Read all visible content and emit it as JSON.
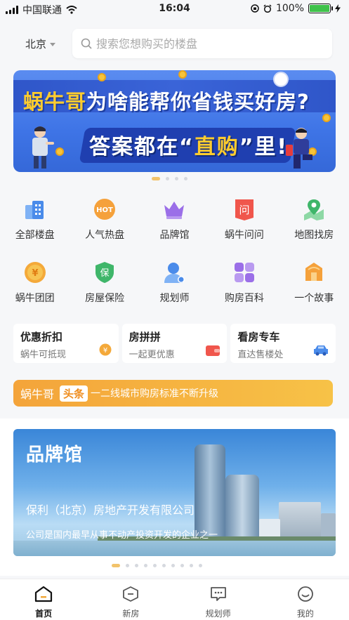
{
  "status_bar": {
    "carrier": "中国联通",
    "time": "16:04",
    "battery": "100%",
    "battery_level": 1.0
  },
  "location": {
    "city": "北京"
  },
  "search": {
    "placeholder": "搜索您想购买的楼盘"
  },
  "banner": {
    "line1_brand": "蜗牛哥",
    "line1_rest": "为啥能帮你省钱买好房?",
    "line2_pre": "答案都在“",
    "line2_highlight": "直购",
    "line2_post": "”里!",
    "pages": 4,
    "active_page": 0
  },
  "quick_menu": [
    {
      "label": "全部楼盘",
      "icon": "buildings-icon",
      "color": "#4a8bea"
    },
    {
      "label": "人气热盘",
      "icon": "hot-icon",
      "color": "#f5a13b"
    },
    {
      "label": "品牌馆",
      "icon": "crown-icon",
      "color": "#9b6fe8"
    },
    {
      "label": "蜗牛问问",
      "icon": "question-icon",
      "color": "#f0564c"
    },
    {
      "label": "地图找房",
      "icon": "map-pin-icon",
      "color": "#3fb66a"
    },
    {
      "label": "蜗牛团团",
      "icon": "coin-icon",
      "color": "#f4a93a"
    },
    {
      "label": "房屋保险",
      "icon": "shield-icon",
      "color": "#3fb66a"
    },
    {
      "label": "规划师",
      "icon": "advisor-icon",
      "color": "#4a8bea"
    },
    {
      "label": "购房百科",
      "icon": "encyclopedia-icon",
      "color": "#9b6fe8"
    },
    {
      "label": "一个故事",
      "icon": "story-icon",
      "color": "#f5a13b"
    }
  ],
  "promo_cards": [
    {
      "title": "优惠折扣",
      "subtitle": "蜗牛可抵现",
      "icon": "discount-coin-icon"
    },
    {
      "title": "房拼拼",
      "subtitle": "一起更优惠",
      "icon": "wallet-icon"
    },
    {
      "title": "看房专车",
      "subtitle": "直达售楼处",
      "icon": "car-icon"
    }
  ],
  "headline": {
    "brand": "蜗牛哥",
    "tag": "头条",
    "text": "一二线城市购房标准不断升级"
  },
  "brand_hall": {
    "title": "品牌馆",
    "company": "保利（北京）房地产开发有限公司",
    "description": "公司是国内最早从事不动产投资开发的企业之一",
    "pages": 10,
    "active_page": 0
  },
  "tab_bar": [
    {
      "label": "首页",
      "icon": "home-icon",
      "active": true
    },
    {
      "label": "新房",
      "icon": "new-house-icon",
      "active": false
    },
    {
      "label": "规划师",
      "icon": "chat-icon",
      "active": false
    },
    {
      "label": "我的",
      "icon": "profile-icon",
      "active": false
    }
  ]
}
